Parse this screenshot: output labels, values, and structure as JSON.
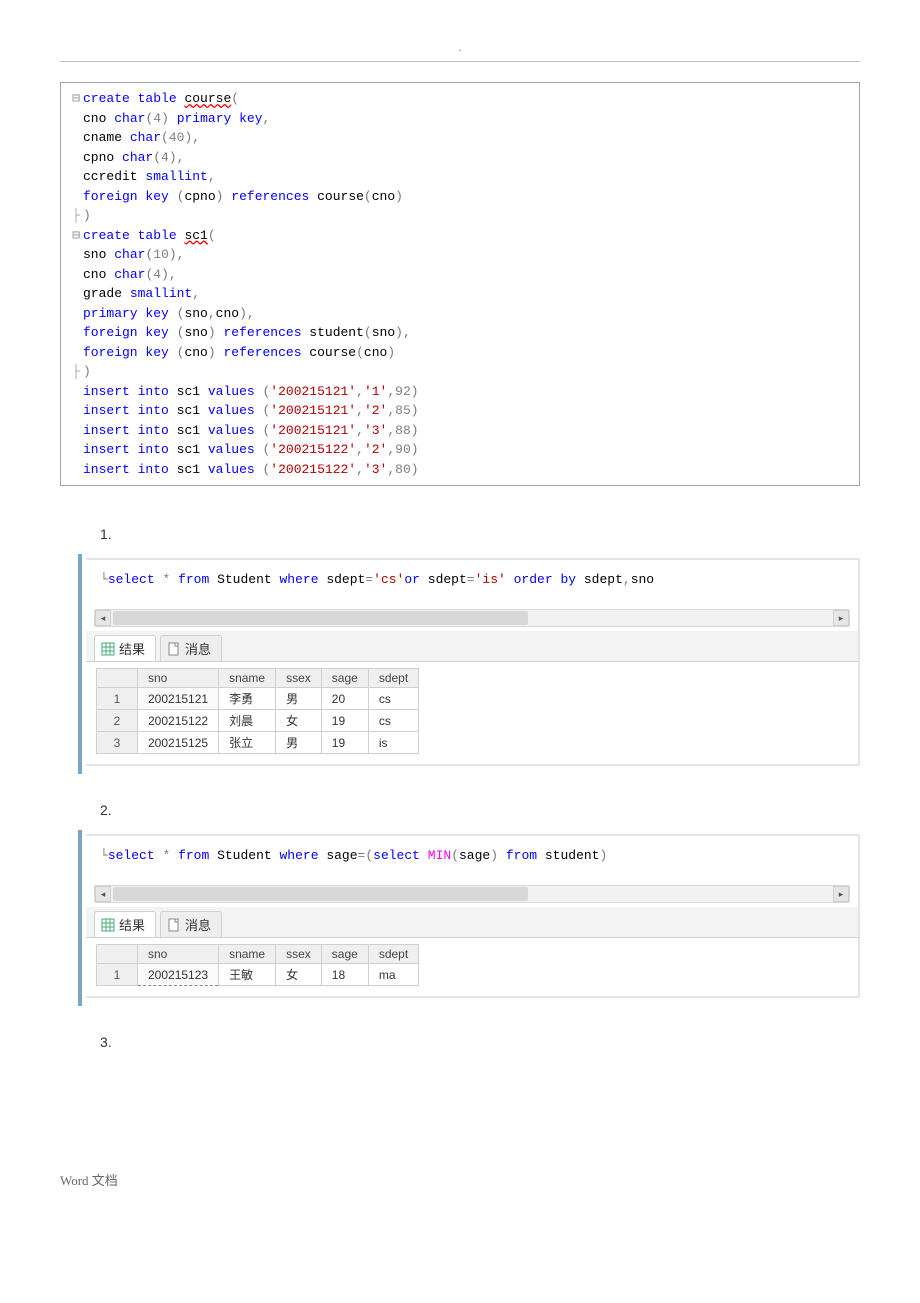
{
  "page_marker": ".",
  "editor_lines": [
    [
      {
        "cls": "fold-col",
        "t": "⊟"
      },
      {
        "cls": "sql-kw",
        "t": "create"
      },
      {
        "cls": "sql-plain",
        "t": " "
      },
      {
        "cls": "sql-kw",
        "t": "table"
      },
      {
        "cls": "sql-plain",
        "t": " "
      },
      {
        "cls": "sql-plain wavy",
        "t": "course"
      },
      {
        "cls": "sql-grey",
        "t": "("
      }
    ],
    [
      {
        "cls": "fold-col",
        "t": ""
      },
      {
        "cls": "sql-plain",
        "t": "cno "
      },
      {
        "cls": "sql-kw",
        "t": "char"
      },
      {
        "cls": "sql-grey",
        "t": "("
      },
      {
        "cls": "sql-num",
        "t": "4"
      },
      {
        "cls": "sql-grey",
        "t": ")"
      },
      {
        "cls": "sql-plain",
        "t": " "
      },
      {
        "cls": "sql-kw",
        "t": "primary"
      },
      {
        "cls": "sql-plain",
        "t": " "
      },
      {
        "cls": "sql-kw",
        "t": "key"
      },
      {
        "cls": "sql-grey",
        "t": ","
      }
    ],
    [
      {
        "cls": "fold-col",
        "t": ""
      },
      {
        "cls": "sql-plain",
        "t": "cname "
      },
      {
        "cls": "sql-kw",
        "t": "char"
      },
      {
        "cls": "sql-grey",
        "t": "("
      },
      {
        "cls": "sql-num",
        "t": "40"
      },
      {
        "cls": "sql-grey",
        "t": ")"
      },
      {
        "cls": "sql-grey",
        "t": ","
      }
    ],
    [
      {
        "cls": "fold-col",
        "t": ""
      },
      {
        "cls": "sql-plain",
        "t": "cpno "
      },
      {
        "cls": "sql-kw",
        "t": "char"
      },
      {
        "cls": "sql-grey",
        "t": "("
      },
      {
        "cls": "sql-num",
        "t": "4"
      },
      {
        "cls": "sql-grey",
        "t": ")"
      },
      {
        "cls": "sql-grey",
        "t": ","
      }
    ],
    [
      {
        "cls": "fold-col",
        "t": ""
      },
      {
        "cls": "sql-plain",
        "t": "ccredit "
      },
      {
        "cls": "sql-kw",
        "t": "smallint"
      },
      {
        "cls": "sql-grey",
        "t": ","
      }
    ],
    [
      {
        "cls": "fold-col",
        "t": ""
      },
      {
        "cls": "sql-kw",
        "t": "foreign"
      },
      {
        "cls": "sql-plain",
        "t": " "
      },
      {
        "cls": "sql-kw",
        "t": "key"
      },
      {
        "cls": "sql-plain",
        "t": " "
      },
      {
        "cls": "sql-grey",
        "t": "("
      },
      {
        "cls": "sql-plain",
        "t": "cpno"
      },
      {
        "cls": "sql-grey",
        "t": ")"
      },
      {
        "cls": "sql-plain",
        "t": " "
      },
      {
        "cls": "sql-kw",
        "t": "references"
      },
      {
        "cls": "sql-plain",
        "t": " course"
      },
      {
        "cls": "sql-grey",
        "t": "("
      },
      {
        "cls": "sql-plain",
        "t": "cno"
      },
      {
        "cls": "sql-grey",
        "t": ")"
      }
    ],
    [
      {
        "cls": "fold-col",
        "t": "├"
      },
      {
        "cls": "sql-grey",
        "t": ")"
      }
    ],
    [
      {
        "cls": "fold-col",
        "t": "⊟"
      },
      {
        "cls": "sql-kw",
        "t": "create"
      },
      {
        "cls": "sql-plain",
        "t": " "
      },
      {
        "cls": "sql-kw",
        "t": "table"
      },
      {
        "cls": "sql-plain",
        "t": " "
      },
      {
        "cls": "sql-plain wavy",
        "t": "sc1"
      },
      {
        "cls": "sql-grey",
        "t": "("
      }
    ],
    [
      {
        "cls": "fold-col",
        "t": ""
      },
      {
        "cls": "sql-plain",
        "t": "sno "
      },
      {
        "cls": "sql-kw",
        "t": "char"
      },
      {
        "cls": "sql-grey",
        "t": "("
      },
      {
        "cls": "sql-num",
        "t": "10"
      },
      {
        "cls": "sql-grey",
        "t": ")"
      },
      {
        "cls": "sql-grey",
        "t": ","
      }
    ],
    [
      {
        "cls": "fold-col",
        "t": ""
      },
      {
        "cls": "sql-plain",
        "t": "cno "
      },
      {
        "cls": "sql-kw",
        "t": "char"
      },
      {
        "cls": "sql-grey",
        "t": "("
      },
      {
        "cls": "sql-num",
        "t": "4"
      },
      {
        "cls": "sql-grey",
        "t": ")"
      },
      {
        "cls": "sql-grey",
        "t": ","
      }
    ],
    [
      {
        "cls": "fold-col",
        "t": ""
      },
      {
        "cls": "sql-plain",
        "t": "grade "
      },
      {
        "cls": "sql-kw",
        "t": "smallint"
      },
      {
        "cls": "sql-grey",
        "t": ","
      }
    ],
    [
      {
        "cls": "fold-col",
        "t": ""
      },
      {
        "cls": "sql-kw",
        "t": "primary"
      },
      {
        "cls": "sql-plain",
        "t": " "
      },
      {
        "cls": "sql-kw",
        "t": "key"
      },
      {
        "cls": "sql-plain",
        "t": " "
      },
      {
        "cls": "sql-grey",
        "t": "("
      },
      {
        "cls": "sql-plain",
        "t": "sno"
      },
      {
        "cls": "sql-grey",
        "t": ","
      },
      {
        "cls": "sql-plain",
        "t": "cno"
      },
      {
        "cls": "sql-grey",
        "t": ")"
      },
      {
        "cls": "sql-grey",
        "t": ","
      }
    ],
    [
      {
        "cls": "fold-col",
        "t": ""
      },
      {
        "cls": "sql-kw",
        "t": "foreign"
      },
      {
        "cls": "sql-plain",
        "t": " "
      },
      {
        "cls": "sql-kw",
        "t": "key"
      },
      {
        "cls": "sql-plain",
        "t": " "
      },
      {
        "cls": "sql-grey",
        "t": "("
      },
      {
        "cls": "sql-plain",
        "t": "sno"
      },
      {
        "cls": "sql-grey",
        "t": ")"
      },
      {
        "cls": "sql-plain",
        "t": " "
      },
      {
        "cls": "sql-kw",
        "t": "references"
      },
      {
        "cls": "sql-plain",
        "t": " student"
      },
      {
        "cls": "sql-grey",
        "t": "("
      },
      {
        "cls": "sql-plain",
        "t": "sno"
      },
      {
        "cls": "sql-grey",
        "t": ")"
      },
      {
        "cls": "sql-grey",
        "t": ","
      }
    ],
    [
      {
        "cls": "fold-col",
        "t": ""
      },
      {
        "cls": "sql-kw",
        "t": "foreign"
      },
      {
        "cls": "sql-plain",
        "t": " "
      },
      {
        "cls": "sql-kw",
        "t": "key"
      },
      {
        "cls": "sql-plain",
        "t": " "
      },
      {
        "cls": "sql-grey",
        "t": "("
      },
      {
        "cls": "sql-plain",
        "t": "cno"
      },
      {
        "cls": "sql-grey",
        "t": ")"
      },
      {
        "cls": "sql-plain",
        "t": " "
      },
      {
        "cls": "sql-kw",
        "t": "references"
      },
      {
        "cls": "sql-plain",
        "t": " course"
      },
      {
        "cls": "sql-grey",
        "t": "("
      },
      {
        "cls": "sql-plain",
        "t": "cno"
      },
      {
        "cls": "sql-grey",
        "t": ")"
      }
    ],
    [
      {
        "cls": "fold-col",
        "t": "├"
      },
      {
        "cls": "sql-grey",
        "t": ")"
      }
    ],
    [
      {
        "cls": "fold-col",
        "t": ""
      },
      {
        "cls": "sql-kw",
        "t": "insert"
      },
      {
        "cls": "sql-plain",
        "t": " "
      },
      {
        "cls": "sql-kw",
        "t": "into"
      },
      {
        "cls": "sql-plain",
        "t": " sc1 "
      },
      {
        "cls": "sql-kw",
        "t": "values"
      },
      {
        "cls": "sql-plain",
        "t": " "
      },
      {
        "cls": "sql-grey",
        "t": "("
      },
      {
        "cls": "sql-str",
        "t": "'200215121'"
      },
      {
        "cls": "sql-grey",
        "t": ","
      },
      {
        "cls": "sql-str",
        "t": "'1'"
      },
      {
        "cls": "sql-grey",
        "t": ","
      },
      {
        "cls": "sql-num",
        "t": "92"
      },
      {
        "cls": "sql-grey",
        "t": ")"
      }
    ],
    [
      {
        "cls": "fold-col",
        "t": ""
      },
      {
        "cls": "sql-kw",
        "t": "insert"
      },
      {
        "cls": "sql-plain",
        "t": " "
      },
      {
        "cls": "sql-kw",
        "t": "into"
      },
      {
        "cls": "sql-plain",
        "t": " sc1 "
      },
      {
        "cls": "sql-kw",
        "t": "values"
      },
      {
        "cls": "sql-plain",
        "t": " "
      },
      {
        "cls": "sql-grey",
        "t": "("
      },
      {
        "cls": "sql-str",
        "t": "'200215121'"
      },
      {
        "cls": "sql-grey",
        "t": ","
      },
      {
        "cls": "sql-str",
        "t": "'2'"
      },
      {
        "cls": "sql-grey",
        "t": ","
      },
      {
        "cls": "sql-num",
        "t": "85"
      },
      {
        "cls": "sql-grey",
        "t": ")"
      }
    ],
    [
      {
        "cls": "fold-col",
        "t": ""
      },
      {
        "cls": "sql-kw",
        "t": "insert"
      },
      {
        "cls": "sql-plain",
        "t": " "
      },
      {
        "cls": "sql-kw",
        "t": "into"
      },
      {
        "cls": "sql-plain",
        "t": " sc1 "
      },
      {
        "cls": "sql-kw",
        "t": "values"
      },
      {
        "cls": "sql-plain",
        "t": " "
      },
      {
        "cls": "sql-grey",
        "t": "("
      },
      {
        "cls": "sql-str",
        "t": "'200215121'"
      },
      {
        "cls": "sql-grey",
        "t": ","
      },
      {
        "cls": "sql-str",
        "t": "'3'"
      },
      {
        "cls": "sql-grey",
        "t": ","
      },
      {
        "cls": "sql-num",
        "t": "88"
      },
      {
        "cls": "sql-grey",
        "t": ")"
      }
    ],
    [
      {
        "cls": "fold-col",
        "t": ""
      },
      {
        "cls": "sql-kw",
        "t": "insert"
      },
      {
        "cls": "sql-plain",
        "t": " "
      },
      {
        "cls": "sql-kw",
        "t": "into"
      },
      {
        "cls": "sql-plain",
        "t": " sc1 "
      },
      {
        "cls": "sql-kw",
        "t": "values"
      },
      {
        "cls": "sql-plain",
        "t": " "
      },
      {
        "cls": "sql-grey",
        "t": "("
      },
      {
        "cls": "sql-str",
        "t": "'200215122'"
      },
      {
        "cls": "sql-grey",
        "t": ","
      },
      {
        "cls": "sql-str",
        "t": "'2'"
      },
      {
        "cls": "sql-grey",
        "t": ","
      },
      {
        "cls": "sql-num",
        "t": "90"
      },
      {
        "cls": "sql-grey",
        "t": ")"
      }
    ],
    [
      {
        "cls": "fold-col",
        "t": ""
      },
      {
        "cls": "sql-kw",
        "t": "insert"
      },
      {
        "cls": "sql-plain",
        "t": " "
      },
      {
        "cls": "sql-kw",
        "t": "into"
      },
      {
        "cls": "sql-plain",
        "t": " sc1 "
      },
      {
        "cls": "sql-kw",
        "t": "values"
      },
      {
        "cls": "sql-plain",
        "t": " "
      },
      {
        "cls": "sql-grey",
        "t": "("
      },
      {
        "cls": "sql-str",
        "t": "'200215122'"
      },
      {
        "cls": "sql-grey",
        "t": ","
      },
      {
        "cls": "sql-str",
        "t": "'3'"
      },
      {
        "cls": "sql-grey",
        "t": ","
      },
      {
        "cls": "sql-num",
        "t": "80"
      },
      {
        "cls": "sql-grey",
        "t": ")"
      }
    ]
  ],
  "sections": [
    {
      "label": "1.",
      "query_tokens": [
        {
          "cls": "sql-grey",
          "t": "└"
        },
        {
          "cls": "sql-kw",
          "t": "select"
        },
        {
          "cls": "sql-plain",
          "t": " "
        },
        {
          "cls": "sql-grey",
          "t": "*"
        },
        {
          "cls": "sql-plain",
          "t": " "
        },
        {
          "cls": "sql-kw",
          "t": "from"
        },
        {
          "cls": "sql-plain",
          "t": " Student "
        },
        {
          "cls": "sql-kw",
          "t": "where"
        },
        {
          "cls": "sql-plain",
          "t": " sdept"
        },
        {
          "cls": "sql-grey",
          "t": "="
        },
        {
          "cls": "sql-str",
          "t": "'cs'"
        },
        {
          "cls": "sql-kw",
          "t": "or"
        },
        {
          "cls": "sql-plain",
          "t": " sdept"
        },
        {
          "cls": "sql-grey",
          "t": "="
        },
        {
          "cls": "sql-str",
          "t": "'is'"
        },
        {
          "cls": "sql-plain",
          "t": " "
        },
        {
          "cls": "sql-kw",
          "t": "order"
        },
        {
          "cls": "sql-plain",
          "t": " "
        },
        {
          "cls": "sql-kw",
          "t": "by"
        },
        {
          "cls": "sql-plain",
          "t": " sdept"
        },
        {
          "cls": "sql-grey",
          "t": ","
        },
        {
          "cls": "sql-plain",
          "t": "sno"
        }
      ],
      "tabs": {
        "results": "结果",
        "messages": "消息"
      },
      "columns": [
        "sno",
        "sname",
        "ssex",
        "sage",
        "sdept"
      ],
      "rows": [
        [
          "200215121",
          "李勇",
          "男",
          "20",
          "cs"
        ],
        [
          "200215122",
          "刘晨",
          "女",
          "19",
          "cs"
        ],
        [
          "200215125",
          "张立",
          "男",
          "19",
          "is"
        ]
      ]
    },
    {
      "label": "2.",
      "query_tokens": [
        {
          "cls": "sql-grey",
          "t": "└"
        },
        {
          "cls": "sql-kw",
          "t": "select"
        },
        {
          "cls": "sql-plain",
          "t": " "
        },
        {
          "cls": "sql-grey",
          "t": "*"
        },
        {
          "cls": "sql-plain",
          "t": " "
        },
        {
          "cls": "sql-kw",
          "t": "from"
        },
        {
          "cls": "sql-plain",
          "t": " Student "
        },
        {
          "cls": "sql-kw",
          "t": "where"
        },
        {
          "cls": "sql-plain",
          "t": " sage"
        },
        {
          "cls": "sql-grey",
          "t": "="
        },
        {
          "cls": "sql-grey",
          "t": "("
        },
        {
          "cls": "sql-kw",
          "t": "select"
        },
        {
          "cls": "sql-plain",
          "t": " "
        },
        {
          "cls": "sql-func",
          "t": "MIN"
        },
        {
          "cls": "sql-grey",
          "t": "("
        },
        {
          "cls": "sql-plain",
          "t": "sage"
        },
        {
          "cls": "sql-grey",
          "t": ")"
        },
        {
          "cls": "sql-plain",
          "t": " "
        },
        {
          "cls": "sql-kw",
          "t": "from"
        },
        {
          "cls": "sql-plain",
          "t": " student"
        },
        {
          "cls": "sql-grey",
          "t": ")"
        }
      ],
      "tabs": {
        "results": "结果",
        "messages": "消息"
      },
      "columns": [
        "sno",
        "sname",
        "ssex",
        "sage",
        "sdept"
      ],
      "rows": [
        [
          "200215123",
          "王敏",
          "女",
          "18",
          "ma"
        ]
      ]
    }
  ],
  "trailing_label": "3.",
  "footer": "Word 文档"
}
